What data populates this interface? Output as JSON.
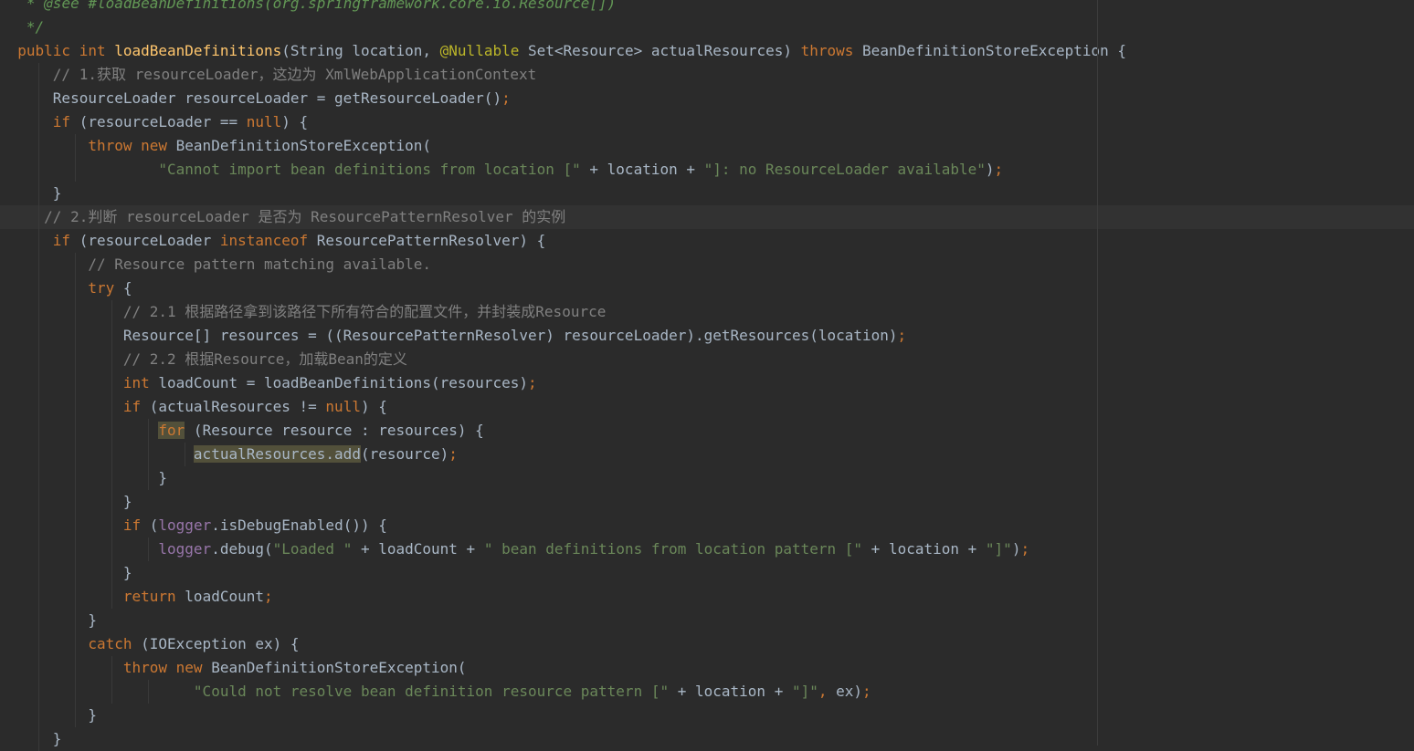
{
  "editor": {
    "language": "java",
    "colors": {
      "background": "#2b2b2b",
      "current_line": "#323232",
      "text": "#a9b7c6",
      "keyword": "#cc7832",
      "method_declaration": "#ffc66d",
      "string": "#6a8759",
      "comment": "#808080",
      "javadoc": "#629755",
      "annotation": "#bbb529",
      "field": "#9876aa",
      "highlight": "#52503a"
    },
    "lines": [
      [
        {
          "t": "   * ",
          "c": "jd"
        },
        {
          "t": "@see",
          "c": "jd"
        },
        {
          "t": " #loadBeanDefinitions(org.springframework.core.io.Resource[])",
          "c": "jd"
        }
      ],
      [
        {
          "t": "   */",
          "c": "jd"
        }
      ],
      [
        {
          "t": "  public ",
          "c": "kw"
        },
        {
          "t": "int ",
          "c": "kw"
        },
        {
          "t": "loadBeanDefinitions",
          "c": "fn"
        },
        {
          "t": "(String location, ",
          "c": ""
        },
        {
          "t": "@Nullable",
          "c": "ann"
        },
        {
          "t": " Set<Resource> actualResources) ",
          "c": ""
        },
        {
          "t": "throws ",
          "c": "kw"
        },
        {
          "t": "BeanDefinitionStoreException {",
          "c": ""
        }
      ],
      [
        {
          "t": "      // 1.获取 resourceLoader，这边为 XmlWebApplicationContext",
          "c": "cm"
        }
      ],
      [
        {
          "t": "      ResourceLoader resourceLoader = getResourceLoader()",
          "c": ""
        },
        {
          "t": ";",
          "c": "kw"
        }
      ],
      [
        {
          "t": "      ",
          "c": ""
        },
        {
          "t": "if ",
          "c": "kw"
        },
        {
          "t": "(resourceLoader == ",
          "c": ""
        },
        {
          "t": "null",
          "c": "kw"
        },
        {
          "t": ") {",
          "c": ""
        }
      ],
      [
        {
          "t": "          ",
          "c": ""
        },
        {
          "t": "throw new ",
          "c": "kw"
        },
        {
          "t": "BeanDefinitionStoreException(",
          "c": ""
        }
      ],
      [
        {
          "t": "                  ",
          "c": ""
        },
        {
          "t": "\"Cannot import bean definitions from location [\"",
          "c": "str"
        },
        {
          "t": " + location + ",
          "c": ""
        },
        {
          "t": "\"]: no ResourceLoader available\"",
          "c": "str"
        },
        {
          "t": ")",
          "c": ""
        },
        {
          "t": ";",
          "c": "kw"
        }
      ],
      [
        {
          "t": "      }",
          "c": ""
        }
      ],
      [
        {
          "t": "     // 2.判断 resourceLoader 是否为 ResourcePatternResolver 的实例",
          "c": "cm"
        }
      ],
      [
        {
          "t": "      ",
          "c": ""
        },
        {
          "t": "if ",
          "c": "kw"
        },
        {
          "t": "(resourceLoader ",
          "c": ""
        },
        {
          "t": "instanceof ",
          "c": "kw"
        },
        {
          "t": "ResourcePatternResolver) {",
          "c": ""
        }
      ],
      [
        {
          "t": "          // Resource pattern matching available.",
          "c": "cm"
        }
      ],
      [
        {
          "t": "          ",
          "c": ""
        },
        {
          "t": "try ",
          "c": "kw"
        },
        {
          "t": "{",
          "c": ""
        }
      ],
      [
        {
          "t": "              // 2.1 根据路径拿到该路径下所有符合的配置文件，并封装成Resource",
          "c": "cm"
        }
      ],
      [
        {
          "t": "              Resource[] resources = ((ResourcePatternResolver) resourceLoader).getResources(location)",
          "c": ""
        },
        {
          "t": ";",
          "c": "kw"
        }
      ],
      [
        {
          "t": "              // 2.2 根据Resource，加载Bean的定义",
          "c": "cm"
        }
      ],
      [
        {
          "t": "              ",
          "c": ""
        },
        {
          "t": "int ",
          "c": "kw"
        },
        {
          "t": "loadCount = loadBeanDefinitions(resources)",
          "c": ""
        },
        {
          "t": ";",
          "c": "kw"
        }
      ],
      [
        {
          "t": "              ",
          "c": ""
        },
        {
          "t": "if ",
          "c": "kw"
        },
        {
          "t": "(actualResources != ",
          "c": ""
        },
        {
          "t": "null",
          "c": "kw"
        },
        {
          "t": ") {",
          "c": ""
        }
      ],
      [
        {
          "t": "                  ",
          "c": ""
        },
        {
          "t": "for",
          "c": "kw hl"
        },
        {
          "t": " (Resource resource : resources) {",
          "c": ""
        }
      ],
      [
        {
          "t": "                      ",
          "c": ""
        },
        {
          "t": "actualResources.add",
          "c": "hl"
        },
        {
          "t": "(resource)",
          "c": ""
        },
        {
          "t": ";",
          "c": "kw"
        }
      ],
      [
        {
          "t": "                  }",
          "c": ""
        }
      ],
      [
        {
          "t": "              }",
          "c": ""
        }
      ],
      [
        {
          "t": "              ",
          "c": ""
        },
        {
          "t": "if ",
          "c": "kw"
        },
        {
          "t": "(",
          "c": ""
        },
        {
          "t": "logger",
          "c": "fld"
        },
        {
          "t": ".isDebugEnabled()) {",
          "c": ""
        }
      ],
      [
        {
          "t": "                  ",
          "c": ""
        },
        {
          "t": "logger",
          "c": "fld"
        },
        {
          "t": ".debug(",
          "c": ""
        },
        {
          "t": "\"Loaded \"",
          "c": "str"
        },
        {
          "t": " + loadCount + ",
          "c": ""
        },
        {
          "t": "\" bean definitions from location pattern [\"",
          "c": "str"
        },
        {
          "t": " + location + ",
          "c": ""
        },
        {
          "t": "\"]\"",
          "c": "str"
        },
        {
          "t": ")",
          "c": ""
        },
        {
          "t": ";",
          "c": "kw"
        }
      ],
      [
        {
          "t": "              }",
          "c": ""
        }
      ],
      [
        {
          "t": "              ",
          "c": ""
        },
        {
          "t": "return ",
          "c": "kw"
        },
        {
          "t": "loadCount",
          "c": ""
        },
        {
          "t": ";",
          "c": "kw"
        }
      ],
      [
        {
          "t": "          }",
          "c": ""
        }
      ],
      [
        {
          "t": "          ",
          "c": ""
        },
        {
          "t": "catch ",
          "c": "kw"
        },
        {
          "t": "(IOException ex) {",
          "c": ""
        }
      ],
      [
        {
          "t": "              ",
          "c": ""
        },
        {
          "t": "throw new ",
          "c": "kw"
        },
        {
          "t": "BeanDefinitionStoreException(",
          "c": ""
        }
      ],
      [
        {
          "t": "                      ",
          "c": ""
        },
        {
          "t": "\"Could not resolve bean definition resource pattern [\"",
          "c": "str"
        },
        {
          "t": " + location + ",
          "c": ""
        },
        {
          "t": "\"]\"",
          "c": "str"
        },
        {
          "t": ", ",
          "c": "kw"
        },
        {
          "t": "ex)",
          "c": ""
        },
        {
          "t": ";",
          "c": "kw"
        }
      ],
      [
        {
          "t": "          }",
          "c": ""
        }
      ],
      [
        {
          "t": "      }",
          "c": ""
        }
      ]
    ]
  }
}
